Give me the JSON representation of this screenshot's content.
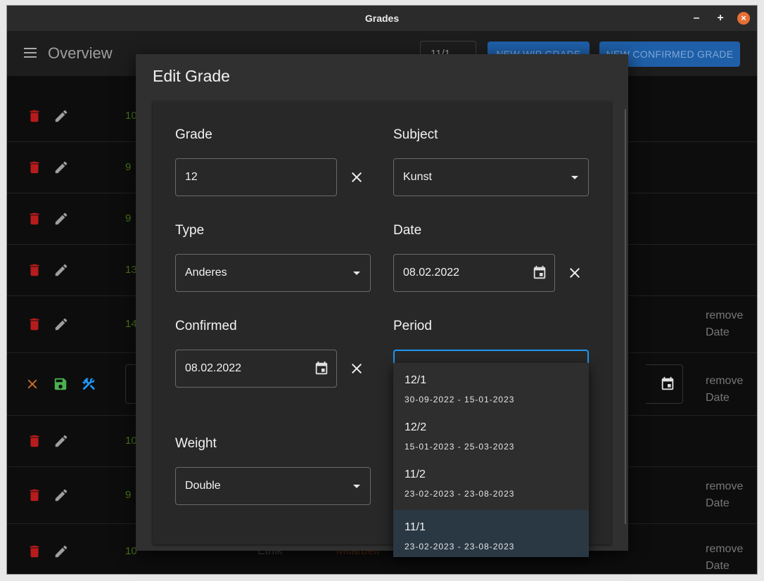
{
  "window": {
    "title": "Grades",
    "min": "–",
    "max": "+",
    "close": "×"
  },
  "appbar": {
    "title": "Overview",
    "period_value": "11/1",
    "new_wip_label": "NEW WIP GRADE",
    "new_confirmed_label": "NEW CONFIRMED GRADE"
  },
  "rows": [
    {
      "grade": "10"
    },
    {
      "grade": "9"
    },
    {
      "grade": "9"
    },
    {
      "grade": "13"
    },
    {
      "grade": "14",
      "remove": "remove",
      "date": "Date"
    },
    {
      "remove": "remove",
      "date": "Date"
    },
    {
      "grade": "10"
    },
    {
      "grade": "9",
      "remove": "remove",
      "date": "Date"
    },
    {
      "grade": "10",
      "subject": "Ethik",
      "type": "Mitarbeit",
      "remove": "remove",
      "date": "Date"
    }
  ],
  "dialog": {
    "title": "Edit Grade",
    "grade": {
      "label": "Grade",
      "value": "12"
    },
    "subject": {
      "label": "Subject",
      "value": "Kunst"
    },
    "type": {
      "label": "Type",
      "value": "Anderes"
    },
    "date": {
      "label": "Date",
      "value": "08.02.2022"
    },
    "confirmed": {
      "label": "Confirmed",
      "value": "08.02.2022"
    },
    "period": {
      "label": "Period",
      "value": ""
    },
    "weight": {
      "label": "Weight",
      "value": "Double"
    }
  },
  "period_menu": {
    "items": [
      {
        "name": "12/1",
        "range": "30-09-2022 - 15-01-2023"
      },
      {
        "name": "12/2",
        "range": "15-01-2023 - 25-03-2023"
      },
      {
        "name": "11/2",
        "range": "23-02-2023 - 23-08-2023"
      },
      {
        "name": "11/1",
        "range": "23-02-2023 - 23-08-2023",
        "selected": true
      }
    ]
  },
  "colors": {
    "accent": "#1e5fa8",
    "trash": "#b71c1c",
    "save": "#4caf50",
    "tool": "#2196f3",
    "cancel": "#d4732a",
    "grade_text": "#4d7a1c",
    "focus_border": "#2196f3"
  },
  "icons": [
    "menu-icon",
    "trash-icon",
    "pencil-icon",
    "close-icon",
    "save-icon",
    "tools-icon",
    "calendar-icon",
    "caret-down-icon"
  ]
}
